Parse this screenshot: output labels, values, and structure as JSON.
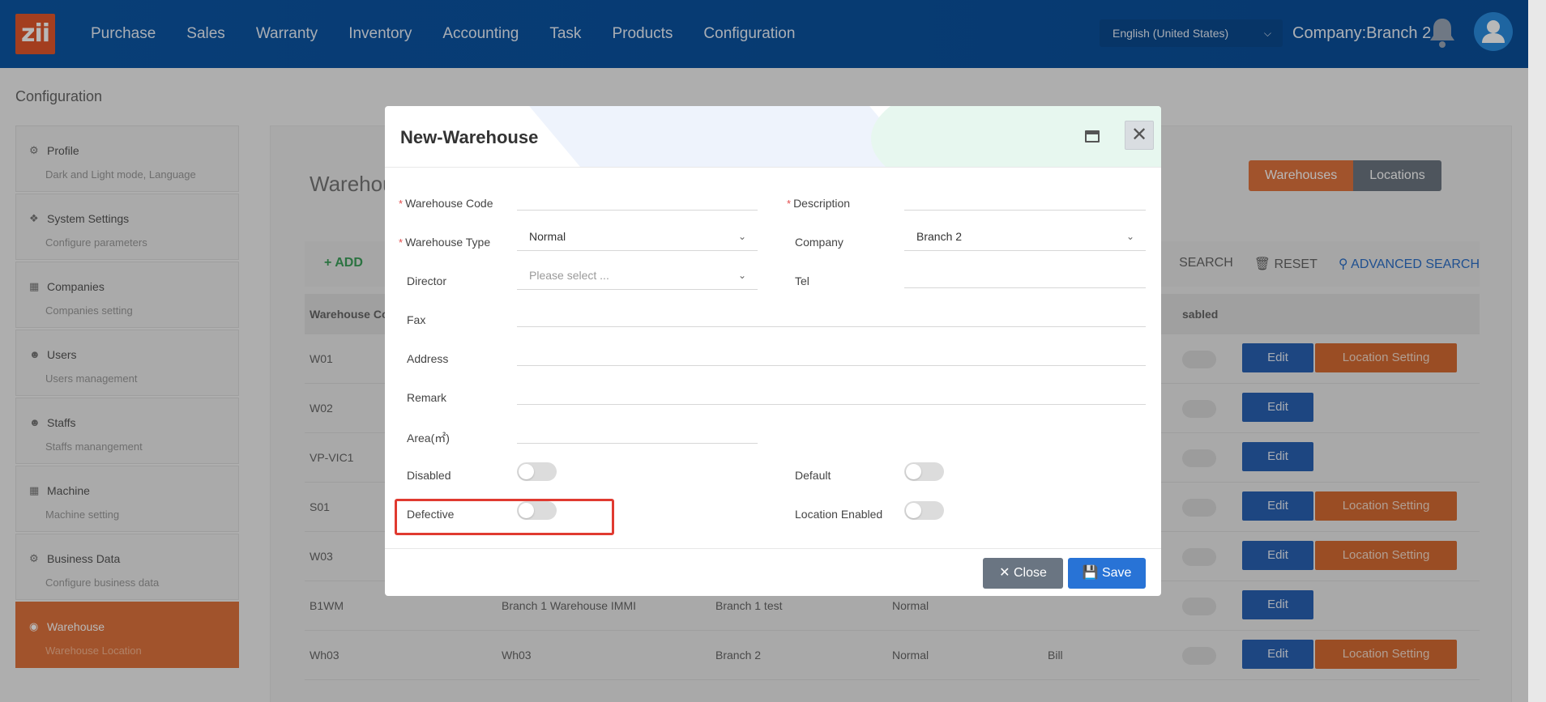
{
  "header": {
    "logo": "zii",
    "nav": [
      "Purchase",
      "Sales",
      "Warranty",
      "Inventory",
      "Accounting",
      "Task",
      "Products",
      "Configuration"
    ],
    "language": "English (United States)",
    "company": "Company:Branch 2"
  },
  "breadcrumb": "Configuration",
  "sidebar": {
    "items": [
      {
        "title": "Profile",
        "sub": "Dark and Light mode, Language"
      },
      {
        "title": "System Settings",
        "sub": "Configure parameters"
      },
      {
        "title": "Companies",
        "sub": "Companies setting"
      },
      {
        "title": "Users",
        "sub": "Users management"
      },
      {
        "title": "Staffs",
        "sub": "Staffs manangement"
      },
      {
        "title": "Machine",
        "sub": "Machine setting"
      },
      {
        "title": "Business Data",
        "sub": "Configure business data"
      },
      {
        "title": "Warehouse",
        "sub": "Warehouse Location"
      }
    ]
  },
  "main": {
    "title": "Warehou",
    "tabs": {
      "warehouses": "Warehouses",
      "locations": "Locations"
    },
    "toolbar": {
      "add": "ADD",
      "search": "SEARCH",
      "reset": "RESET",
      "advanced": "ADVANCED SEARCH"
    },
    "columns": {
      "code": "Warehouse Co",
      "disabled": "sabled"
    },
    "rows": [
      {
        "code": "W01",
        "name": "",
        "company": "",
        "type": "",
        "director": "",
        "loc": true
      },
      {
        "code": "W02",
        "name": "",
        "company": "",
        "type": "",
        "director": "",
        "loc": false
      },
      {
        "code": "VP-VIC1",
        "name": "",
        "company": "",
        "type": "",
        "director": "",
        "loc": false
      },
      {
        "code": "S01",
        "name": "",
        "company": "",
        "type": "",
        "director": "",
        "loc": true
      },
      {
        "code": "W03",
        "name": "",
        "company": "",
        "type": "",
        "director": "",
        "loc": true
      },
      {
        "code": "B1WM",
        "name": "Branch 1 Warehouse IMMI",
        "company": "Branch 1 test",
        "type": "Normal",
        "director": "",
        "loc": false
      },
      {
        "code": "Wh03",
        "name": "Wh03",
        "company": "Branch 2",
        "type": "Normal",
        "director": "Bill",
        "loc": true
      }
    ],
    "edit_label": "Edit",
    "location_label": "Location Setting"
  },
  "modal": {
    "title": "New-Warehouse",
    "fields": {
      "warehouse_code": "Warehouse Code",
      "description": "Description",
      "warehouse_type": "Warehouse Type",
      "warehouse_type_value": "Normal",
      "company": "Company",
      "company_value": "Branch 2",
      "director": "Director",
      "director_placeholder": "Please select ...",
      "tel": "Tel",
      "fax": "Fax",
      "address": "Address",
      "remark": "Remark",
      "area": "Area(㎡)",
      "disabled": "Disabled",
      "default": "Default",
      "defective": "Defective",
      "location_enabled": "Location Enabled"
    },
    "close": "Close",
    "save": "Save"
  }
}
